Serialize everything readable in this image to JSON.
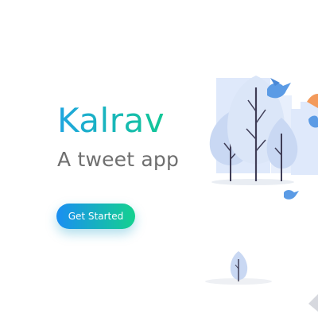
{
  "hero": {
    "brand_name": "Kalrav",
    "tagline": "A tweet app",
    "cta_label": "Get Started"
  },
  "colors": {
    "brand_start": "#1fa5e0",
    "brand_end": "#12c795",
    "cta_start": "#1a8ef2",
    "cta_end": "#14d18f",
    "tagline": "#6f6f6f",
    "building": "#dfe9fb",
    "tree_fill": "#c9d8f3",
    "tree_trunk": "#3f3d56",
    "bird": "#5b9be5",
    "accent_orange": "#f39a5b"
  },
  "illustration": {
    "icons": [
      "tree-icon",
      "bird-icon",
      "building-icon"
    ]
  }
}
